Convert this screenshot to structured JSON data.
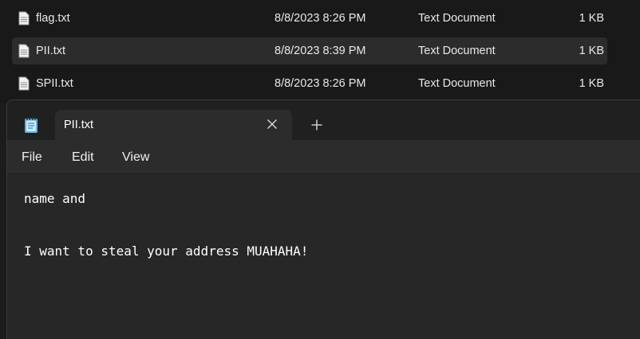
{
  "explorer": {
    "files": [
      {
        "name": "flag.txt",
        "date": "8/8/2023 8:26 PM",
        "type": "Text Document",
        "size": "1 KB",
        "selected": false
      },
      {
        "name": "PII.txt",
        "date": "8/8/2023 8:39 PM",
        "type": "Text Document",
        "size": "1 KB",
        "selected": true
      },
      {
        "name": "SPII.txt",
        "date": "8/8/2023 8:26 PM",
        "type": "Text Document",
        "size": "1 KB",
        "selected": false
      }
    ]
  },
  "notepad": {
    "tab_title": "PII.txt",
    "menu": {
      "file": "File",
      "edit": "Edit",
      "view": "View"
    },
    "content_lines": [
      "name and",
      "",
      "I want to steal your address MUAHAHA!"
    ],
    "icons": {
      "app": "notepad-icon",
      "close": "close-icon",
      "new_tab": "plus-icon",
      "file": "text-file-icon"
    },
    "colors": {
      "accent": "#5eb3e8"
    }
  }
}
